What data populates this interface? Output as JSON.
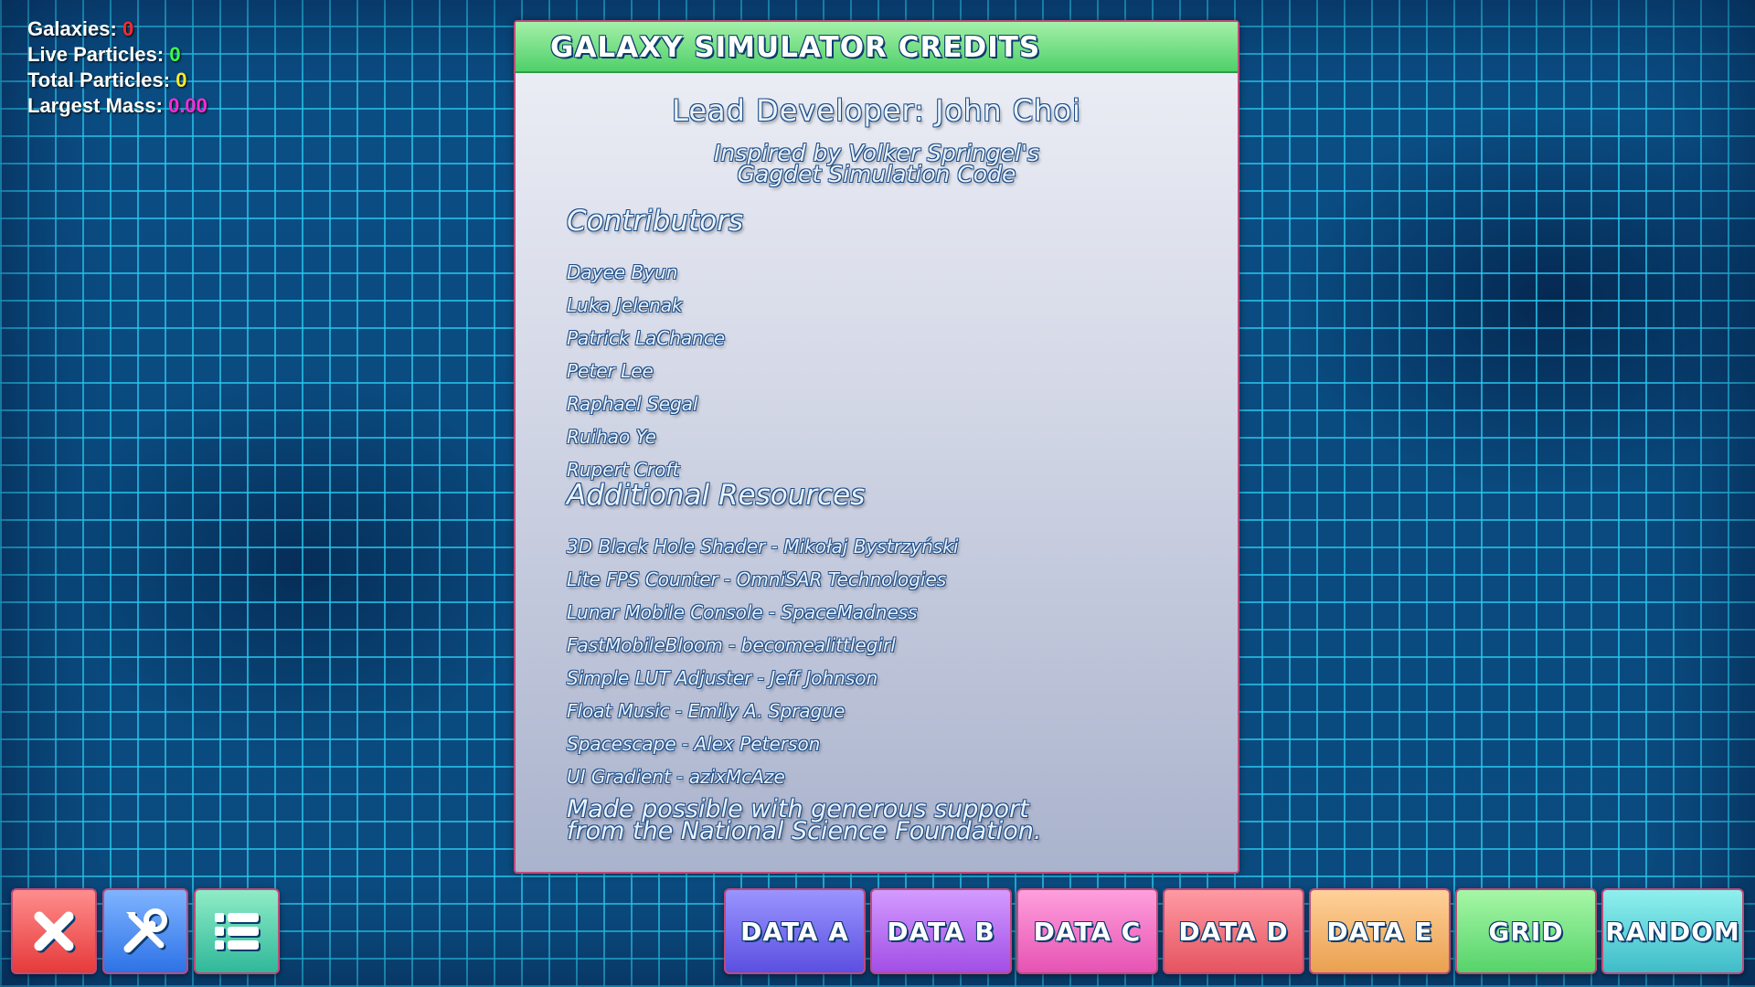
{
  "stats": {
    "galaxies_label": "Galaxies:",
    "galaxies_value": "0",
    "live_label": "Live Particles:",
    "live_value": "0",
    "total_label": "Total Particles:",
    "total_value": "0",
    "mass_label": "Largest Mass:",
    "mass_value": "0.00",
    "colors": {
      "galaxies": "#ff2a2a",
      "live": "#3cff4a",
      "total": "#ffea2a",
      "mass": "#ff2ad8"
    }
  },
  "credits": {
    "title": "GALAXY SIMULATOR CREDITS",
    "lead": "Lead Developer: John Choi",
    "inspired_line1": "Inspired by Volker Springel's",
    "inspired_line2": "Gagdet Simulation Code",
    "contributors_heading": "Contributors",
    "contributors": [
      "Dayee Byun",
      "Luka Jelenak",
      "Patrick LaChance",
      "Peter Lee",
      "Raphael Segal",
      "Ruihao Ye",
      "Rupert Croft"
    ],
    "resources_heading": "Additional Resources",
    "resources": [
      "3D Black Hole Shader - Mikołaj Bystrzyński",
      "Lite FPS Counter - OmniSAR Technologies",
      "Lunar Mobile Console - SpaceMadness",
      "FastMobileBloom - becomealittlegirl",
      "Simple LUT Adjuster - Jeff Johnson",
      "Float Music - Emily A. Sprague",
      "Spacescape - Alex Peterson",
      "UI Gradient - azixMcAze"
    ],
    "support_line1": "Made possible with generous support",
    "support_line2": "from the National Science Foundation."
  },
  "toolbar": {
    "icons": [
      "close-icon",
      "tools-icon",
      "list-icon"
    ],
    "data_a": "DATA A",
    "data_b": "DATA B",
    "data_c": "DATA C",
    "data_d": "DATA D",
    "data_e": "DATA E",
    "grid": "GRID",
    "random": "RANDOM"
  }
}
